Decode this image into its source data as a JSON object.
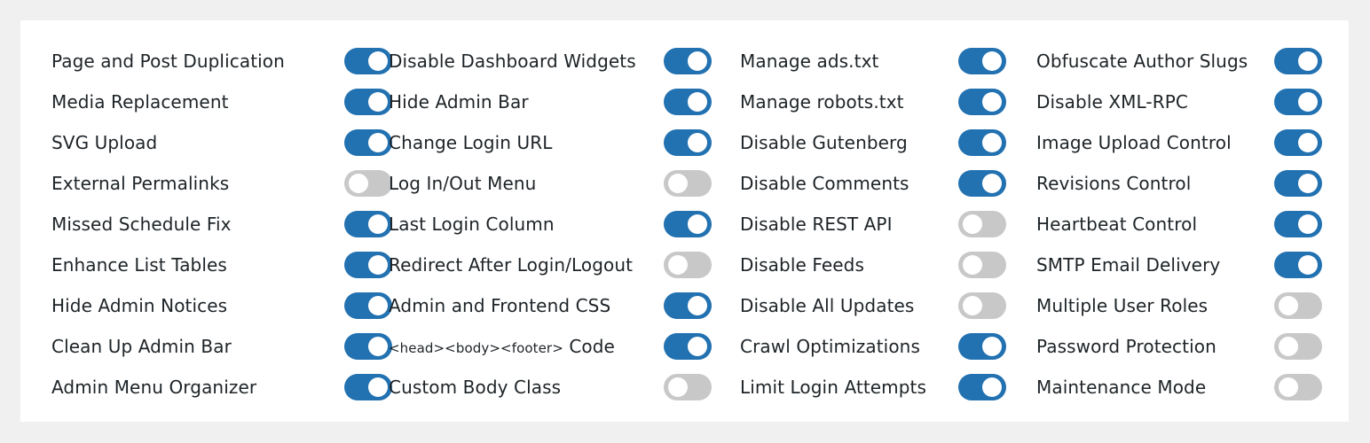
{
  "colors": {
    "toggle_on": "#2271b1",
    "toggle_off": "#c8c8c8",
    "panel_bg": "#ffffff",
    "page_bg": "#f0f0f1"
  },
  "columns": [
    {
      "items": [
        {
          "label": "Page and Post Duplication",
          "enabled": true
        },
        {
          "label": "Media Replacement",
          "enabled": true
        },
        {
          "label": "SVG Upload",
          "enabled": true
        },
        {
          "label": "External Permalinks",
          "enabled": false
        },
        {
          "label": "Missed Schedule Fix",
          "enabled": true
        },
        {
          "label": "Enhance List Tables",
          "enabled": true
        },
        {
          "label": "Hide Admin Notices",
          "enabled": true
        },
        {
          "label": "Clean Up Admin Bar",
          "enabled": true
        },
        {
          "label": "Admin Menu Organizer",
          "enabled": true
        }
      ]
    },
    {
      "items": [
        {
          "label": "Disable Dashboard Widgets",
          "enabled": true
        },
        {
          "label": "Hide Admin Bar",
          "enabled": true
        },
        {
          "label": "Change Login URL",
          "enabled": true
        },
        {
          "label": "Log In/Out Menu",
          "enabled": false
        },
        {
          "label": "Last Login Column",
          "enabled": true
        },
        {
          "label": "Redirect After Login/Logout",
          "enabled": false
        },
        {
          "label": "Admin and Frontend CSS",
          "enabled": true
        },
        {
          "label": "<head><body><footer> Code",
          "enabled": true,
          "code_prefix": "<head><body><footer>",
          "code_suffix": " Code"
        },
        {
          "label": "Custom Body Class",
          "enabled": false
        }
      ]
    },
    {
      "items": [
        {
          "label": "Manage ads.txt",
          "enabled": true
        },
        {
          "label": "Manage robots.txt",
          "enabled": true
        },
        {
          "label": "Disable Gutenberg",
          "enabled": true
        },
        {
          "label": "Disable Comments",
          "enabled": true
        },
        {
          "label": "Disable REST API",
          "enabled": false
        },
        {
          "label": "Disable Feeds",
          "enabled": false
        },
        {
          "label": "Disable All Updates",
          "enabled": false
        },
        {
          "label": "Crawl Optimizations",
          "enabled": true
        },
        {
          "label": "Limit Login Attempts",
          "enabled": true
        }
      ]
    },
    {
      "items": [
        {
          "label": "Obfuscate Author Slugs",
          "enabled": true
        },
        {
          "label": "Disable XML-RPC",
          "enabled": true
        },
        {
          "label": "Image Upload Control",
          "enabled": true
        },
        {
          "label": "Revisions Control",
          "enabled": true
        },
        {
          "label": "Heartbeat Control",
          "enabled": true
        },
        {
          "label": "SMTP Email Delivery",
          "enabled": true
        },
        {
          "label": "Multiple User Roles",
          "enabled": false
        },
        {
          "label": "Password Protection",
          "enabled": false
        },
        {
          "label": "Maintenance Mode",
          "enabled": false
        }
      ]
    }
  ]
}
